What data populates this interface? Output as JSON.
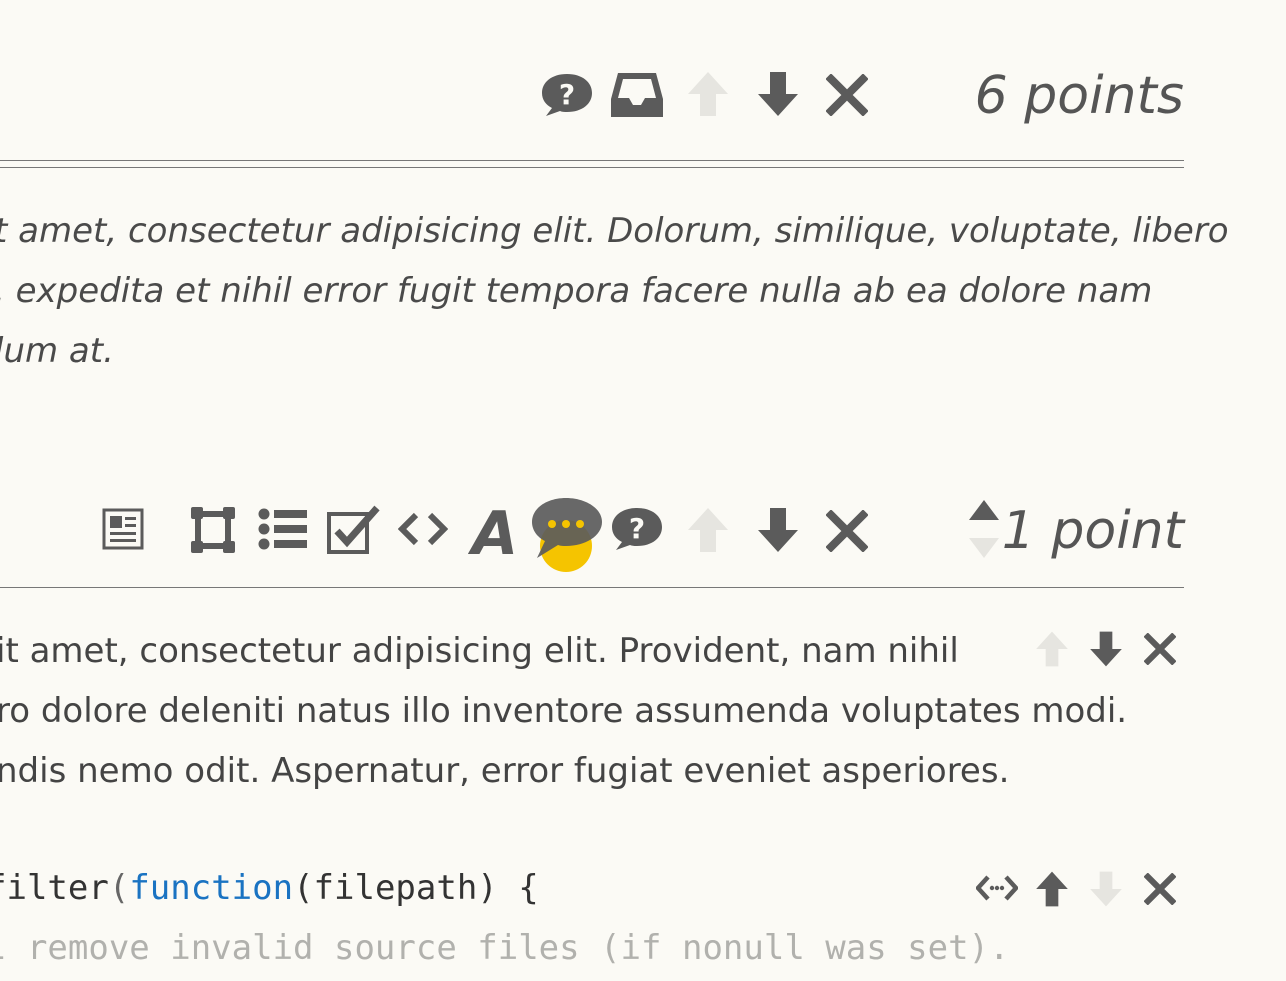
{
  "block1": {
    "points": "6 points",
    "toolbar_icons": [
      "question-bubble-icon",
      "inbox-icon",
      "arrow-up-icon",
      "arrow-down-icon",
      "close-icon"
    ],
    "lines": [
      "t amet, consectetur adipisicing elit. Dolorum, similique, voluptate, libero",
      ", expedita et nihil error fugit tempora facere nulla ab ea dolore nam",
      "lum at."
    ]
  },
  "block2": {
    "points": "1 point",
    "toolbar_icons": [
      "document-icon",
      "frame-icon",
      "list-icon",
      "checkbox-icon",
      "code-icon",
      "font-icon",
      "chat-bubble-icon",
      "question-bubble-icon",
      "arrow-up-icon",
      "arrow-down-icon",
      "close-icon",
      "stepper-icon"
    ],
    "para_lines": [
      "it amet, consectetur adipisicing elit. Provident, nam nihil",
      "ro dolore deleniti natus illo inventore assumenda voluptates modi.",
      "ndis nemo odit. Aspernatur, error fugiat eveniet asperiores."
    ],
    "code": {
      "prefix": "filter",
      "paren_open": "(",
      "keyword": "function",
      "param": "(filepath) {",
      "comment": "l remove invalid source files (if nonull was set)."
    }
  },
  "colors": {
    "background": "#fbfaf5",
    "icon": "#5b5b5b",
    "icon_disabled": "#e6e5e0",
    "accent_yellow": "#f5c400",
    "keyword_blue": "#1a73c2"
  }
}
